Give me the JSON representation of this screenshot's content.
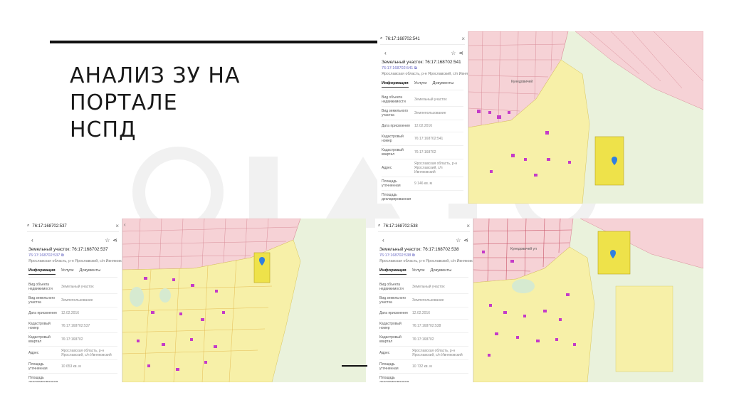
{
  "slide": {
    "title_lines": [
      "АНАЛИЗ ЗУ НА",
      "ПОРТАЛЕ",
      "НСПД"
    ]
  },
  "icons": {
    "search": "search-icon",
    "close": "close-icon",
    "back": "chevron-left-icon",
    "favorite": "star-icon",
    "share": "share-icon",
    "map_marker": "map-marker-icon",
    "collapse": "chevron-left-icon",
    "copy": "copy-icon"
  },
  "colors": {
    "parcel_pink": "#f6d2d6",
    "parcel_outline": "#d98f9a",
    "zone_yellow": "#f7f0a8",
    "highlight_yellow": "#eee24a",
    "building_magenta": "#c43bc8",
    "marker_blue": "#2f7fe0",
    "accent_link": "#6b6bc4"
  },
  "screens": [
    {
      "search_query": "76:17:168702:541",
      "title": "Земельный участок: 76:17:168702:541",
      "link": "76:17:168702:541",
      "address": "Ярославская область, р-н Ярославский, с/п Ивняковский",
      "tabs": [
        "Информация",
        "Услуги",
        "Документы"
      ],
      "rows": [
        {
          "key": "Вид объекта недвижимости",
          "value": "Земельный участок"
        },
        {
          "key": "Вид земельного участка",
          "value": "Землепользование"
        },
        {
          "key": "Дата присвоения",
          "value": "12.02.2016"
        },
        {
          "key": "Кадастровый номер",
          "value": "76:17:168702:541"
        },
        {
          "key": "Кадастровый квартал",
          "value": "76:17:168702"
        },
        {
          "key": "Адрес",
          "value": "Ярославская область, р-н Ярославский, с/п Ивняковский"
        },
        {
          "key": "Площадь уточненная",
          "value": "9 146 кв. м"
        },
        {
          "key": "Площадь декларированная",
          "value": ""
        }
      ],
      "map_street_label": "Кунедовичей"
    },
    {
      "search_query": "76:17:168702:537",
      "title": "Земельный участок: 76:17:168702:537",
      "link": "76:17:168702:537",
      "address": "Ярославская область, р-н Ярославский, с/п Ивняковский",
      "tabs": [
        "Информация",
        "Услуги",
        "Документы"
      ],
      "rows": [
        {
          "key": "Вид объекта недвижимости",
          "value": "Земельный участок"
        },
        {
          "key": "Вид земельного участка",
          "value": "Землепользование"
        },
        {
          "key": "Дата присвоения",
          "value": "12.02.2016"
        },
        {
          "key": "Кадастровый номер",
          "value": "76:17:168702:537"
        },
        {
          "key": "Кадастровый квартал",
          "value": "76:17:168702"
        },
        {
          "key": "Адрес",
          "value": "Ярославская область, р-н Ярославский, с/п Ивняковский"
        },
        {
          "key": "Площадь уточненная",
          "value": "10 653 кв. м"
        },
        {
          "key": "Площадь декларированная",
          "value": ""
        }
      ],
      "map_street_label": ""
    },
    {
      "search_query": "76:17:168702:538",
      "title": "Земельный участок: 76:17:168702:538",
      "link": "76:17:168702:538",
      "address": "Ярославская область, р-н Ярославский, с/п Ивняковский",
      "tabs": [
        "Информация",
        "Услуги",
        "Документы"
      ],
      "rows": [
        {
          "key": "Вид объекта недвижимости",
          "value": "Земельный участок"
        },
        {
          "key": "Вид земельного участка",
          "value": "Землепользование"
        },
        {
          "key": "Дата присвоения",
          "value": "12.02.2016"
        },
        {
          "key": "Кадастровый номер",
          "value": "76:17:168702:538"
        },
        {
          "key": "Кадастровый квартал",
          "value": "76:17:168702"
        },
        {
          "key": "Адрес",
          "value": "Ярославская область, р-н Ярославский, с/п Ивняковский"
        },
        {
          "key": "Площадь уточненная",
          "value": "10 732 кв. м"
        },
        {
          "key": "Площадь декларированная",
          "value": ""
        }
      ],
      "map_street_label": "Кунедовичей ул"
    }
  ]
}
